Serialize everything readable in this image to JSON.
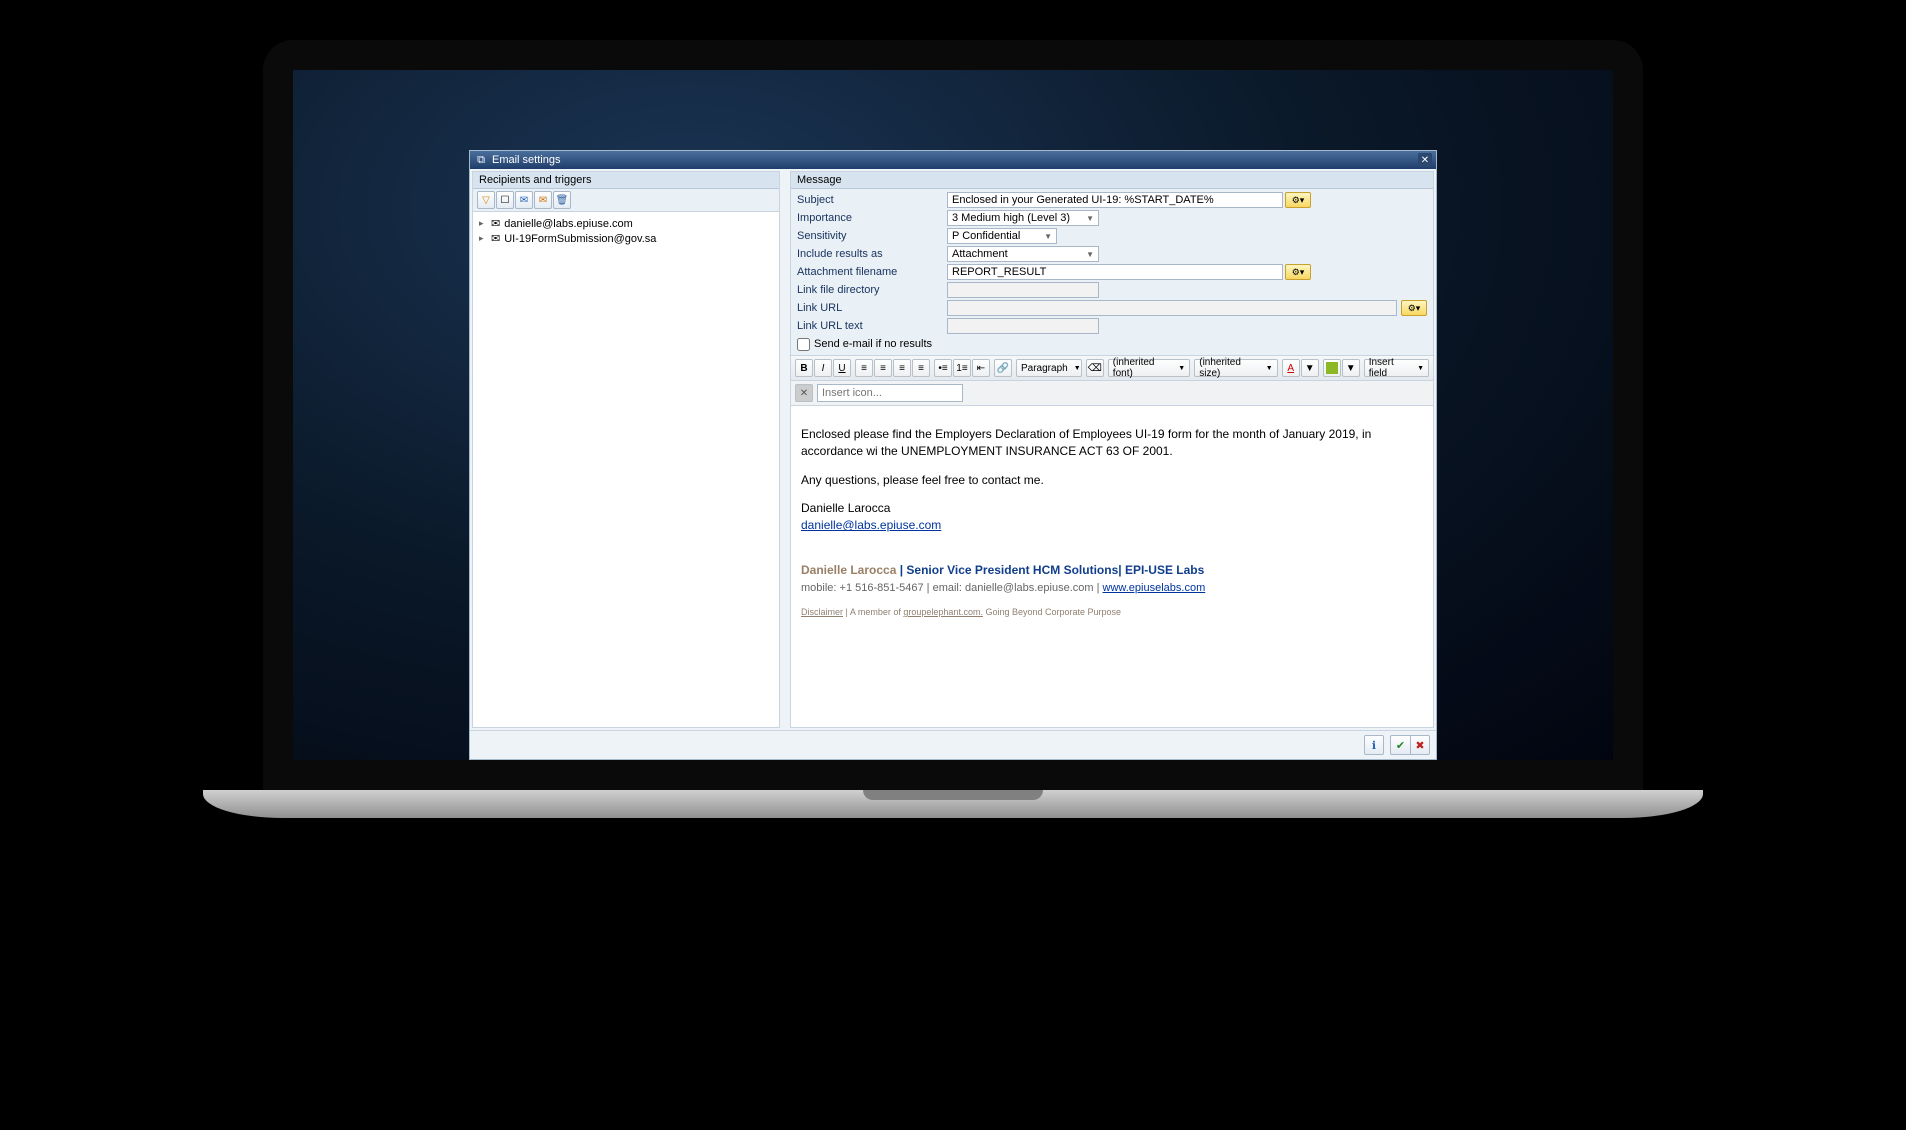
{
  "window": {
    "title": "Email settings"
  },
  "left": {
    "header": "Recipients and triggers",
    "tree": {
      "items": [
        "danielle@labs.epiuse.com",
        "UI-19FormSubmission@gov.sa"
      ]
    }
  },
  "right": {
    "header": "Message",
    "fields": {
      "subject_label": "Subject",
      "subject_value": "Enclosed in your Generated UI-19: %START_DATE%",
      "importance_label": "Importance",
      "importance_value": "3 Medium high (Level 3)",
      "sensitivity_label": "Sensitivity",
      "sensitivity_value": "P Confidential",
      "include_label": "Include results as",
      "include_value": "Attachment",
      "attach_fn_label": "Attachment filename",
      "attach_fn_value": "REPORT_RESULT",
      "link_dir_label": "Link file directory",
      "link_dir_value": "",
      "link_url_label": "Link URL",
      "link_url_value": "",
      "link_url_text_label": "Link URL text",
      "link_url_text_value": "",
      "send_if_no_label": "Send e-mail if no results"
    }
  },
  "editor": {
    "para_label": "Paragraph",
    "font_label": "(inherited font)",
    "size_label": "(inherited size)",
    "insert_field_label": "Insert field",
    "insert_icon_placeholder": "Insert icon..."
  },
  "body": {
    "p1": "Enclosed please find the Employers Declaration of Employees UI-19 form for the month of January 2019, in accordance wi the UNEMPLOYMENT INSURANCE ACT 63 OF 2001.",
    "p2": "Any questions, please feel free to contact me.",
    "signer": "Danielle Larocca",
    "signer_email": "danielle@labs.epiuse.com",
    "sig_name": "Danielle Larocca",
    "sig_sep": " | ",
    "sig_title": "Senior Vice President HCM Solutions",
    "sig_company_sep": "| ",
    "sig_company": "EPI-USE Labs",
    "sig_contact_pre": "mobile: +1 516-851-5467 | email: danielle@labs.epiuse.com  |  ",
    "sig_link": " www.epiuselabs.com ",
    "disclaimer_label": "Disclaimer",
    "member_text": " | A member of ",
    "member_link": "groupelephant.com.",
    "tagline": " Going Beyond Corporate Purpose"
  },
  "footer": {
    "info": "ℹ",
    "ok": "✔",
    "cancel": "✖"
  }
}
